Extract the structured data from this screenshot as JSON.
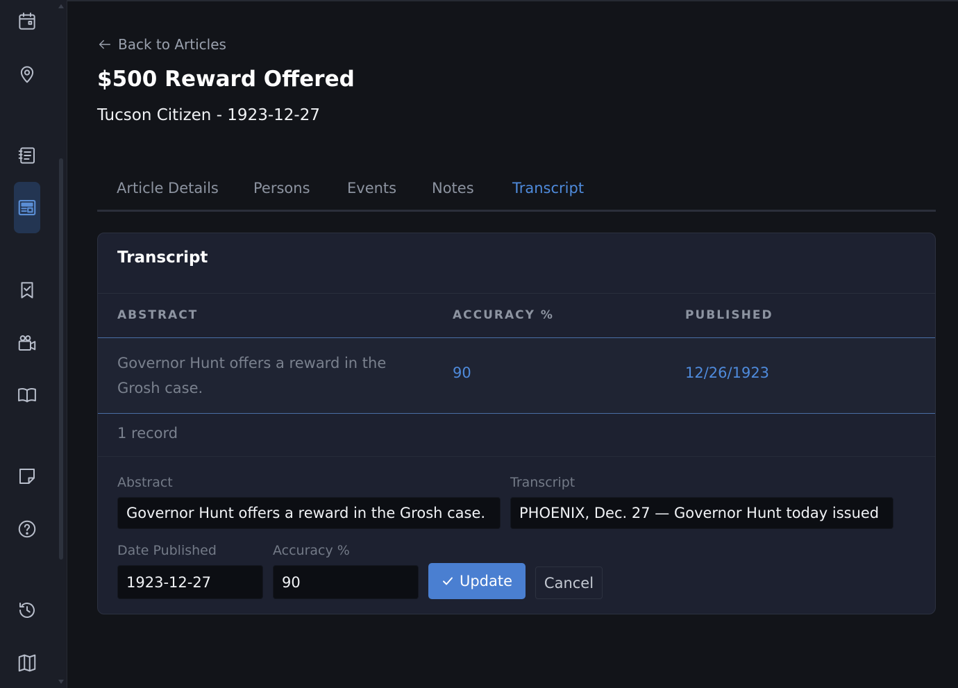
{
  "sidebar": {
    "icons": [
      {
        "name": "calendar-icon"
      },
      {
        "name": "location-pin-icon"
      },
      {
        "name": "notebook-icon"
      },
      {
        "name": "newspaper-icon",
        "active": true
      },
      {
        "name": "bookmark-check-icon"
      },
      {
        "name": "video-camera-icon"
      },
      {
        "name": "book-open-icon"
      },
      {
        "name": "sticky-note-icon"
      },
      {
        "name": "help-circle-icon"
      },
      {
        "name": "history-clock-icon"
      },
      {
        "name": "map-icon"
      }
    ]
  },
  "header": {
    "back_label": "Back to Articles",
    "title": "$500 Reward Offered",
    "subtitle": "Tucson Citizen - 1923-12-27"
  },
  "tabs": [
    {
      "label": "Article Details",
      "active": false
    },
    {
      "label": "Persons",
      "active": false
    },
    {
      "label": "Events",
      "active": false
    },
    {
      "label": "Notes",
      "active": false
    },
    {
      "label": "Transcript",
      "active": true
    }
  ],
  "transcript_card": {
    "title": "Transcript",
    "columns": [
      "ABSTRACT",
      "ACCURACY %",
      "PUBLISHED"
    ],
    "rows": [
      {
        "abstract": "Governor Hunt offers a reward in the Grosh case.",
        "accuracy": "90",
        "published": "12/26/1923"
      }
    ],
    "record_count": "1 record"
  },
  "form": {
    "abstract_label": "Abstract",
    "abstract_value": "Governor Hunt offers a reward in the Grosh case.",
    "transcript_label": "Transcript",
    "transcript_value": "PHOENIX, Dec. 27 — Governor Hunt today issued",
    "date_label": "Date Published",
    "date_value": "1923-12-27",
    "accuracy_label": "Accuracy %",
    "accuracy_value": "90",
    "update_label": "Update",
    "cancel_label": "Cancel"
  },
  "colors": {
    "accent": "#4f8bdc",
    "background": "#121419",
    "card": "#1d2130"
  }
}
